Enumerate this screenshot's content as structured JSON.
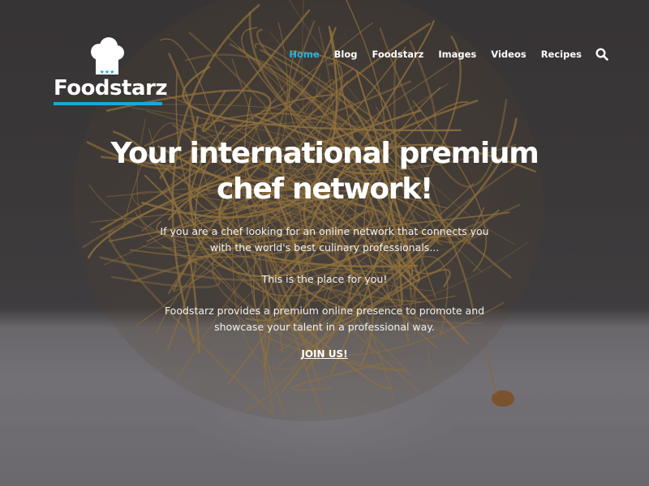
{
  "brand": {
    "name": "Foodstarz",
    "accent": "#27b5e0"
  },
  "nav": {
    "items": [
      {
        "label": "Home",
        "active": true
      },
      {
        "label": "Blog"
      },
      {
        "label": "Foodstarz"
      },
      {
        "label": "Images"
      },
      {
        "label": "Videos"
      },
      {
        "label": "Recipes"
      }
    ],
    "search_icon": "search-icon"
  },
  "hero": {
    "title_line1": "Your international premium",
    "title_line2": "chef network!",
    "paragraph1": "If you are a chef looking for an online network that connects you with the world's best culinary professionals...",
    "paragraph2": "This is the place for you!",
    "paragraph3": "Foodstarz provides a premium online presence to promote and showcase your talent in a professional way.",
    "cta": "JOIN US!"
  }
}
